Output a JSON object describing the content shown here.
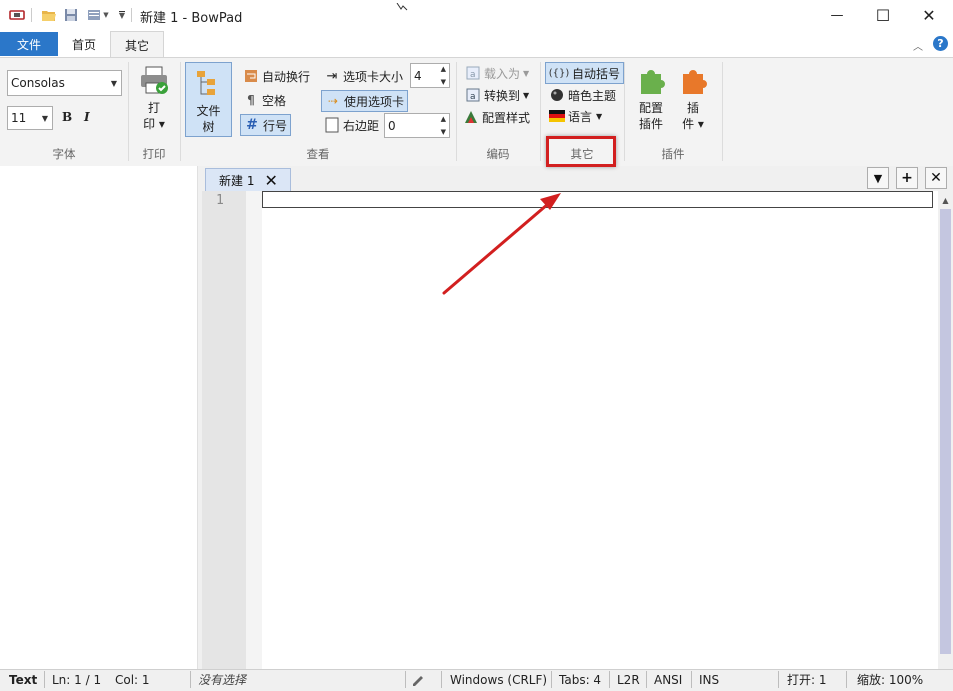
{
  "titlebar": {
    "title": "新建 1 - BowPad",
    "quick_access": [
      "app-icon",
      "open-icon",
      "save-icon",
      "recent-icon",
      "customize-icon"
    ]
  },
  "window_controls": {
    "minimize": "—",
    "maximize": "☐",
    "close": "✕"
  },
  "ribbon_tabs": [
    {
      "label": "文件",
      "active": false,
      "style": "file"
    },
    {
      "label": "首页",
      "active": false
    },
    {
      "label": "其它",
      "active": true
    }
  ],
  "ribbon": {
    "groups": {
      "font": {
        "label": "字体",
        "font_name": "Consolas",
        "font_size": "11",
        "bold": "B",
        "italic": "I"
      },
      "print": {
        "label": "打印",
        "print_button": "打\n印"
      },
      "view": {
        "label": "查看",
        "file_tree": "文件\n树",
        "word_wrap": "自动换行",
        "whitespace": "空格",
        "line_numbers": "行号",
        "tab_size_label": "选项卡大小",
        "tab_size_value": "4",
        "use_tabs": "使用选项卡",
        "right_margin_label": "右边距",
        "right_margin_value": "0"
      },
      "encoding": {
        "label": "编码",
        "load_as": "载入为",
        "convert_to": "转换到",
        "config_style": "配置样式"
      },
      "other": {
        "label": "其它",
        "auto_brace": "自动括号",
        "dark_theme": "暗色主题",
        "language": "语言"
      },
      "plugins": {
        "label": "插件",
        "config_plugins": "配置\n插件",
        "plugins": "插\n件"
      }
    }
  },
  "document": {
    "tab_label": "新建 1",
    "line_numbers": [
      "1"
    ],
    "strip_buttons": {
      "dropdown": "▼",
      "add": "+",
      "close": "✕"
    }
  },
  "statusbar": {
    "lexer": "Text",
    "position": "Ln: 1 / 1",
    "column": "Col: 1",
    "selection": "没有选择",
    "eol": "Windows (CRLF)",
    "tabs": "Tabs: 4",
    "direction": "L2R",
    "encoding": "ANSI",
    "insert_mode": "INS",
    "open_count": "打开: 1",
    "zoom": "缩放: 100%"
  },
  "colors": {
    "file_tab": "#2b77c9",
    "ribbon_bg": "#f3f3f3",
    "highlight": "#d21f1f",
    "scroll_thumb": "#c4c6e0"
  }
}
